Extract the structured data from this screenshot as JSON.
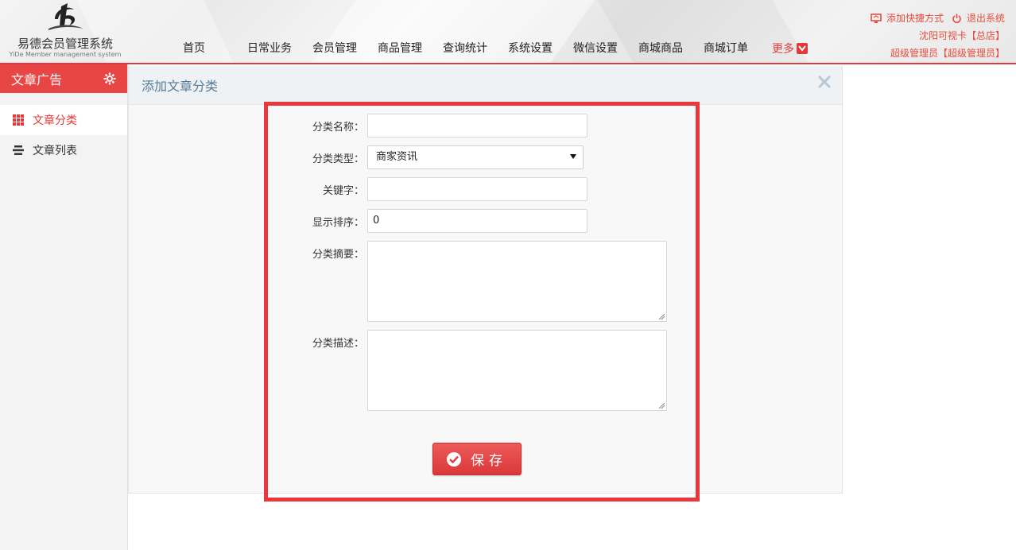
{
  "app": {
    "logo_cn": "易德会员管理系统",
    "logo_en": "YiDe Member management system"
  },
  "nav": {
    "items": [
      "首页",
      "日常业务",
      "会员管理",
      "商品管理",
      "查询统计",
      "系统设置",
      "微信设置",
      "商城商品",
      "商城订单"
    ],
    "more": "更多"
  },
  "top_right": {
    "shortcut": "添加快捷方式",
    "logout": "退出系统",
    "store": "沈阳可视卡【总店】",
    "user": "超级管理员【超级管理员】"
  },
  "sidebar": {
    "title": "文章广告",
    "items": [
      {
        "label": "文章分类",
        "icon": "grid-icon",
        "active": true
      },
      {
        "label": "文章列表",
        "icon": "list-icon",
        "active": false
      }
    ]
  },
  "panel": {
    "title": "添加文章分类"
  },
  "form": {
    "name_label": "分类名称：",
    "name_value": "",
    "type_label": "分类类型：",
    "type_value": "商家资讯",
    "keyword_label": "关键字：",
    "keyword_value": "",
    "order_label": "显示排序：",
    "order_value": "0",
    "summary_label": "分类摘要：",
    "desc_label": "分类描述：",
    "save_label": "保存"
  },
  "colors": {
    "accent": "#e84545",
    "panel_title": "#587b95",
    "highlight": "#e8383b"
  }
}
